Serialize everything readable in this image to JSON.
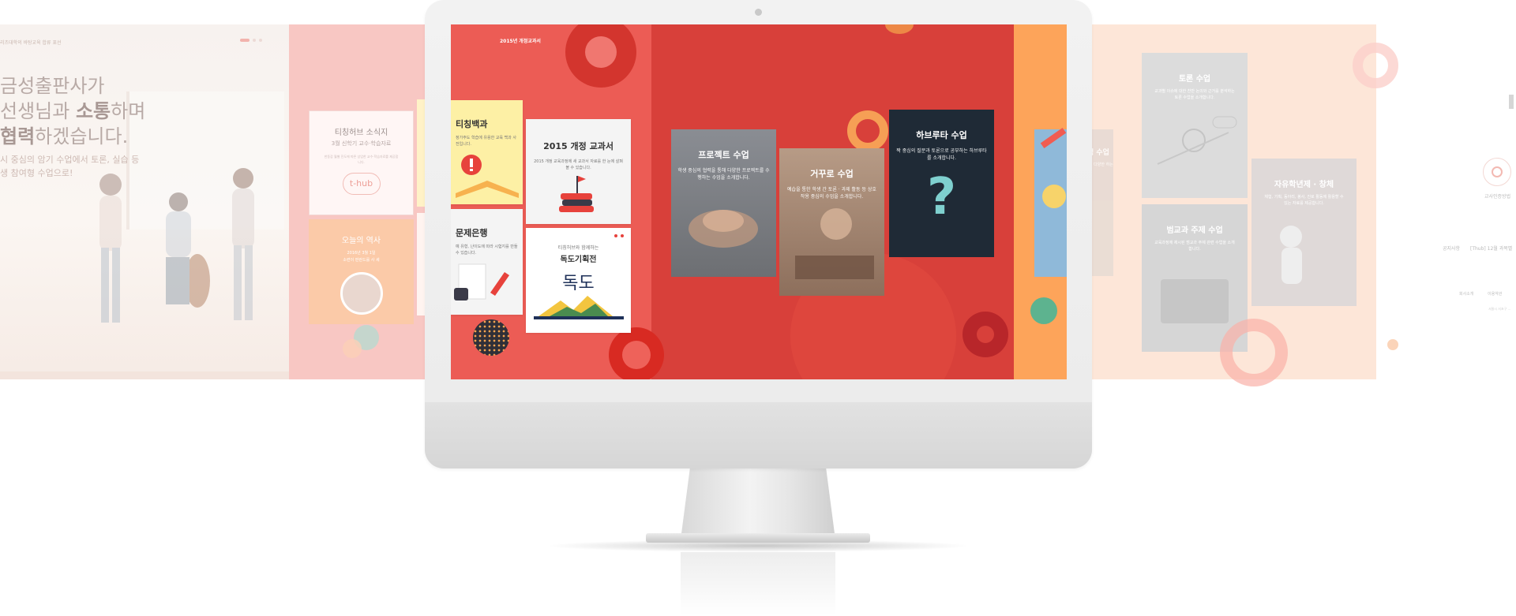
{
  "left_panel": {
    "topbar_text": "리츠대학의 바탕교육 합류 표선",
    "headline_line1": "금성출판사가",
    "headline_line2_a": "선생님과 ",
    "headline_line2_b": "소통",
    "headline_line2_c": "하며",
    "headline_line3_a": "협력",
    "headline_line3_b": "하겠습니다.",
    "sub_line1": "시 중심의 암기 수업에서 토론, 실습 등",
    "sub_line2": "생 참여형 수업으로!"
  },
  "pink_panel": {
    "news_title": "티칭허브 소식지",
    "news_sub": "3월 신학기 교수·학습자료",
    "news_desc": "한동갑 월별 진도에 따른 상업한 교수·학습자료를 제공합니다.",
    "logo_text": "t-hub",
    "today_title": "오늘의 역사",
    "today_date": "2016년 3월 1일",
    "today_desc": "소련이 핀란드를 사 세"
  },
  "screen": {
    "brand_tag": "2015년 개정교과서",
    "teaching_title": "티칭백과",
    "teaching_desc": "정가주도 학습에 유용한 교육 백과 사전입니다.",
    "textbook_title": "2015 개정 교과서",
    "textbook_desc": "2015 개정 교육과정에 새 교과서 자료를 한 눈에 살펴볼 수 있습니다.",
    "bank_title": "문제은행",
    "bank_desc": "예 유형, 난이도에 따라 시험지를 만들 수 있습니다.",
    "dokdo_kicker": "티칭허브와 함께하는",
    "dokdo_title": "독도기획전",
    "dokdo_art": "독도",
    "project_title": "프로젝트 수업",
    "project_desc": "학생 중심의 협력을 통해 다양한 프로젝트를 수행하는 수업을 소개합니다.",
    "flip_title": "거꾸로 수업",
    "flip_desc": "예습을 통한 학생 간 토론 · 과제 활동 등 상호작용 중심의 수업을 소개합니다.",
    "havruta_title": "하브루타 수업",
    "havruta_desc": "짝 중심의 질문과 토론으로 공부하는 하브루타를 소개합니다.",
    "havruta_icon": "?"
  },
  "peach_panel": {
    "partial_title": "비 · 정 수업",
    "partial_desc": "글과 생각이 다양한 하는 ... 니다.",
    "debate_title": "토론 수업",
    "debate_desc": "교과별 이슈에 대한 찬반 논의와 근거를 분석하는 토론 수업을 소개합니다.",
    "free_title": "자유학년제 · 창체",
    "free_desc": "체험, 기획, 동아리, 봉사, 진로 활동에 활용할 수 있는 자료를 제공합니다.",
    "law_title": "범교과 주제 수업",
    "law_desc": "교육과정에 제시된 범교과 주제 관련 수업을 소개합니다."
  },
  "far_right": {
    "icon_label": "교사인증방법",
    "notice_label": "공지사항",
    "notice_text": "[Thub] 12월 과목별",
    "footer_a": "회사소개",
    "footer_b": "이용약관",
    "addr": "서울시 서초구 ..."
  },
  "colors": {
    "screen_red": "#d8403a",
    "screen_coral": "#ec5c55",
    "screen_orange": "#fda45a",
    "pink": "#f8c7c3",
    "peach": "#fde6d8"
  }
}
